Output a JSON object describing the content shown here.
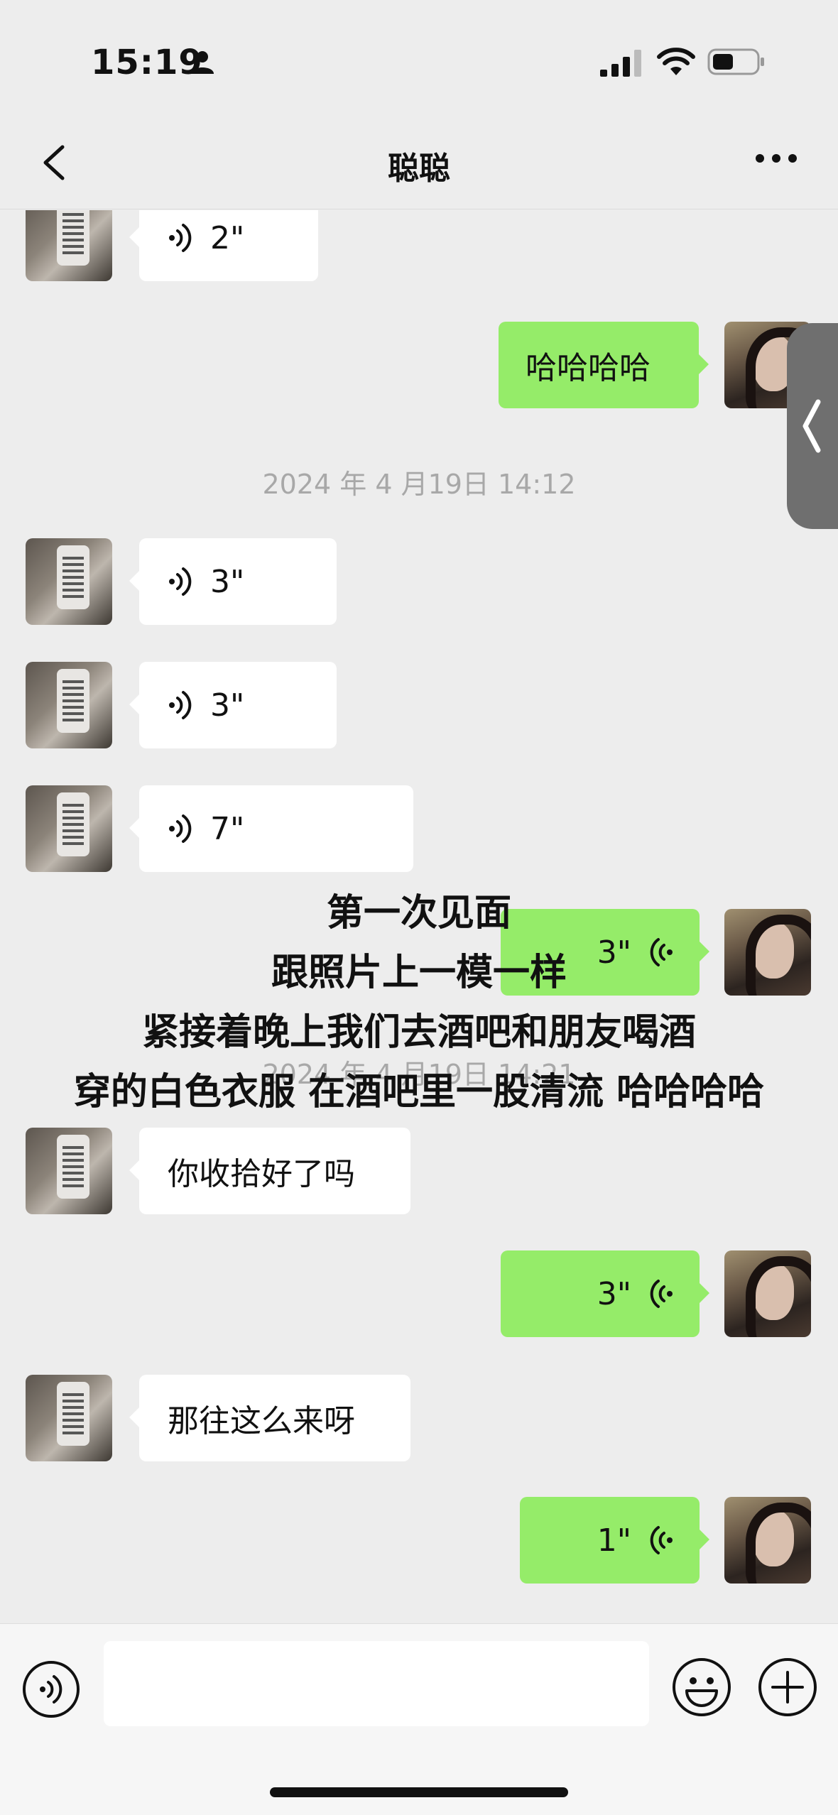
{
  "status_bar": {
    "time": "15:19",
    "icons": [
      "person-icon",
      "signal-icon",
      "wifi-icon",
      "battery-icon"
    ]
  },
  "header": {
    "title": "聪聪",
    "back_icon": "chevron-left-icon",
    "more_icon": "ellipsis-icon"
  },
  "messages": [
    {
      "side": "in",
      "type": "voice",
      "duration": "2\""
    },
    {
      "side": "out",
      "type": "text",
      "text": "哈哈哈哈"
    },
    {
      "side": "system",
      "type": "timestamp",
      "text": "2024 年 4 月19日 14:12"
    },
    {
      "side": "in",
      "type": "voice",
      "duration": "3\""
    },
    {
      "side": "in",
      "type": "voice",
      "duration": "3\""
    },
    {
      "side": "in",
      "type": "voice",
      "duration": "7\""
    },
    {
      "side": "out",
      "type": "voice",
      "duration": "3\""
    },
    {
      "side": "system",
      "type": "timestamp",
      "text": "2024 年 4 月19日 14:21"
    },
    {
      "side": "in",
      "type": "text",
      "text": "你收拾好了吗"
    },
    {
      "side": "out",
      "type": "voice",
      "duration": "3\""
    },
    {
      "side": "in",
      "type": "text",
      "text": "那往这么来呀"
    },
    {
      "side": "out",
      "type": "voice",
      "duration": "1\""
    }
  ],
  "overlay_caption": [
    "第一次见面",
    "跟照片上一模一样",
    "紧接着晚上我们去酒吧和朋友喝酒",
    "穿的白色衣服 在酒吧里一股清流 哈哈哈哈"
  ],
  "input_bar": {
    "value": "",
    "icons": [
      "voice-mode-icon",
      "emoji-icon",
      "plus-icon"
    ]
  },
  "colors": {
    "background": "#ededed",
    "outgoing_bubble": "#95ec69",
    "incoming_bubble": "#ffffff",
    "timestamp_text": "#a8a8a8"
  }
}
